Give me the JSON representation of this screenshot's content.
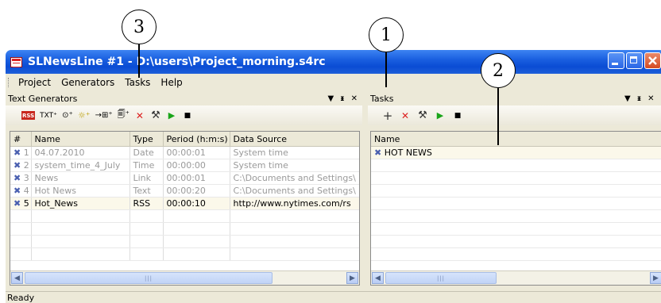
{
  "callouts": [
    "1",
    "2",
    "3"
  ],
  "window": {
    "title": "SLNewsLine #1 - D:\\users\\Project_morning.s4rc"
  },
  "menu": [
    "Project",
    "Generators",
    "Tasks",
    "Help"
  ],
  "generators_panel": {
    "title": "Text Generators",
    "controls": [
      "▼",
      "ᵻ",
      "✕"
    ],
    "toolbar": [
      "RSS",
      "TXT⁺",
      "⊙⁺",
      "☼⁺",
      "→⊞⁺",
      "🗐⁺",
      "✕",
      "⚒",
      "▶",
      "■"
    ],
    "columns": [
      "#",
      "Name",
      "Type",
      "Period (h:m:s)",
      "Data Source"
    ],
    "rows": [
      {
        "num": "1",
        "name": "04.07.2010",
        "type": "Date",
        "period": "00:00:01",
        "source": "System time"
      },
      {
        "num": "2",
        "name": "system_time_4_July",
        "type": "Time",
        "period": "00:00:00",
        "source": "System time"
      },
      {
        "num": "3",
        "name": "News",
        "type": "Link",
        "period": "00:00:01",
        "source": "C:\\Documents and Settings\\"
      },
      {
        "num": "4",
        "name": "Hot News",
        "type": "Text",
        "period": "00:00:20",
        "source": "C:\\Documents and Settings\\"
      },
      {
        "num": "5",
        "name": "Hot_News",
        "type": "RSS",
        "period": "00:00:10",
        "source": "http://www.nytimes.com/rs"
      }
    ]
  },
  "tasks_panel": {
    "title": "Tasks",
    "controls": [
      "▼",
      "ᵻ",
      "✕"
    ],
    "toolbar": [
      "+",
      "✕",
      "⚒",
      "▶",
      "■"
    ],
    "columns": [
      "Name"
    ],
    "rows": [
      {
        "name": "HOT NEWS"
      }
    ]
  },
  "status": {
    "text": "Ready"
  },
  "colors": {
    "title_bar": "#0a4cd4",
    "chrome": "#ece9d8",
    "task_icon": "#4a5fb0"
  }
}
